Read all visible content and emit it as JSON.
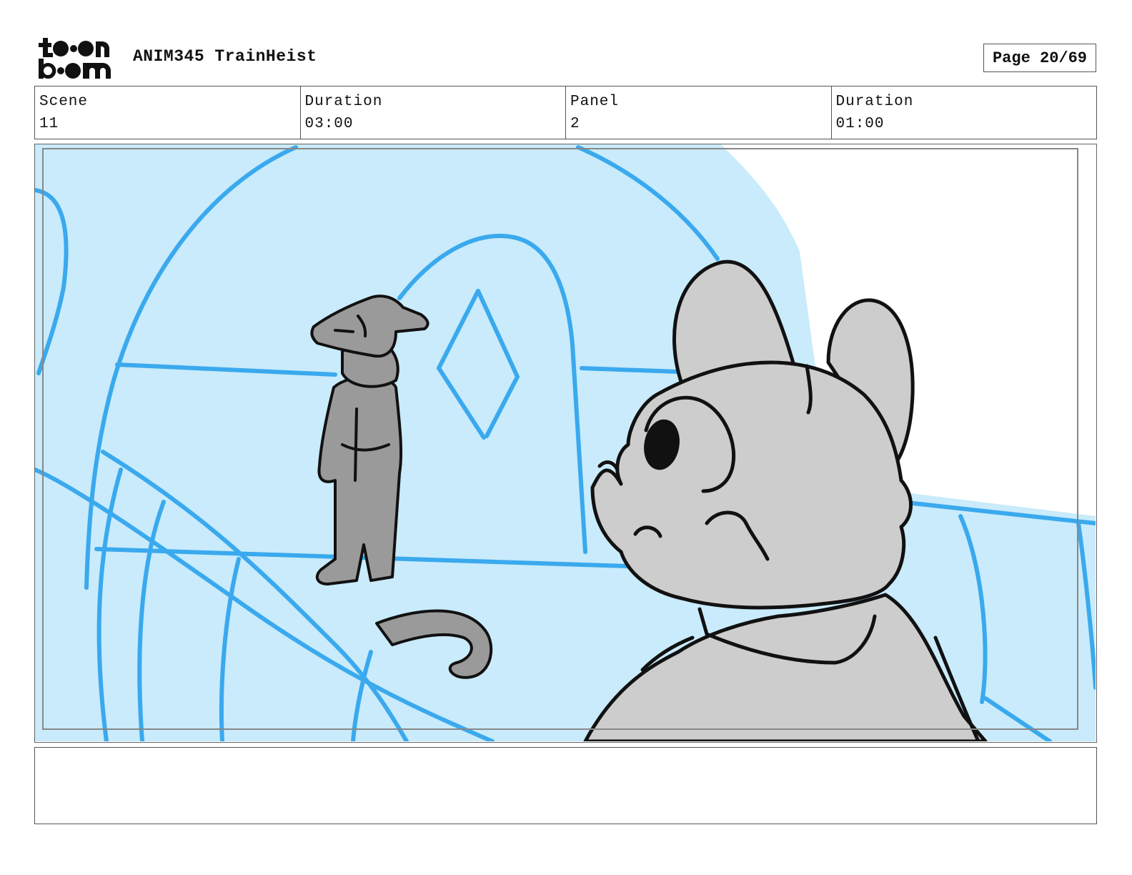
{
  "header": {
    "logo_text": "toon boom",
    "project_title": "ANIM345 TrainHeist",
    "page_label": "Page 20/69"
  },
  "info": {
    "scene_label": "Scene",
    "scene_value": "11",
    "scene_duration_label": "Duration",
    "scene_duration_value": "03:00",
    "panel_label": "Panel",
    "panel_value": "2",
    "panel_duration_label": "Duration",
    "panel_duration_value": "01:00"
  },
  "colors": {
    "background_fill": "#c9ebfb",
    "background_lines": "#3aa9ee",
    "character_fill": "#cdcdcd",
    "character_dark_fill": "#9a9a9a",
    "ink": "#111111"
  },
  "notes": ""
}
